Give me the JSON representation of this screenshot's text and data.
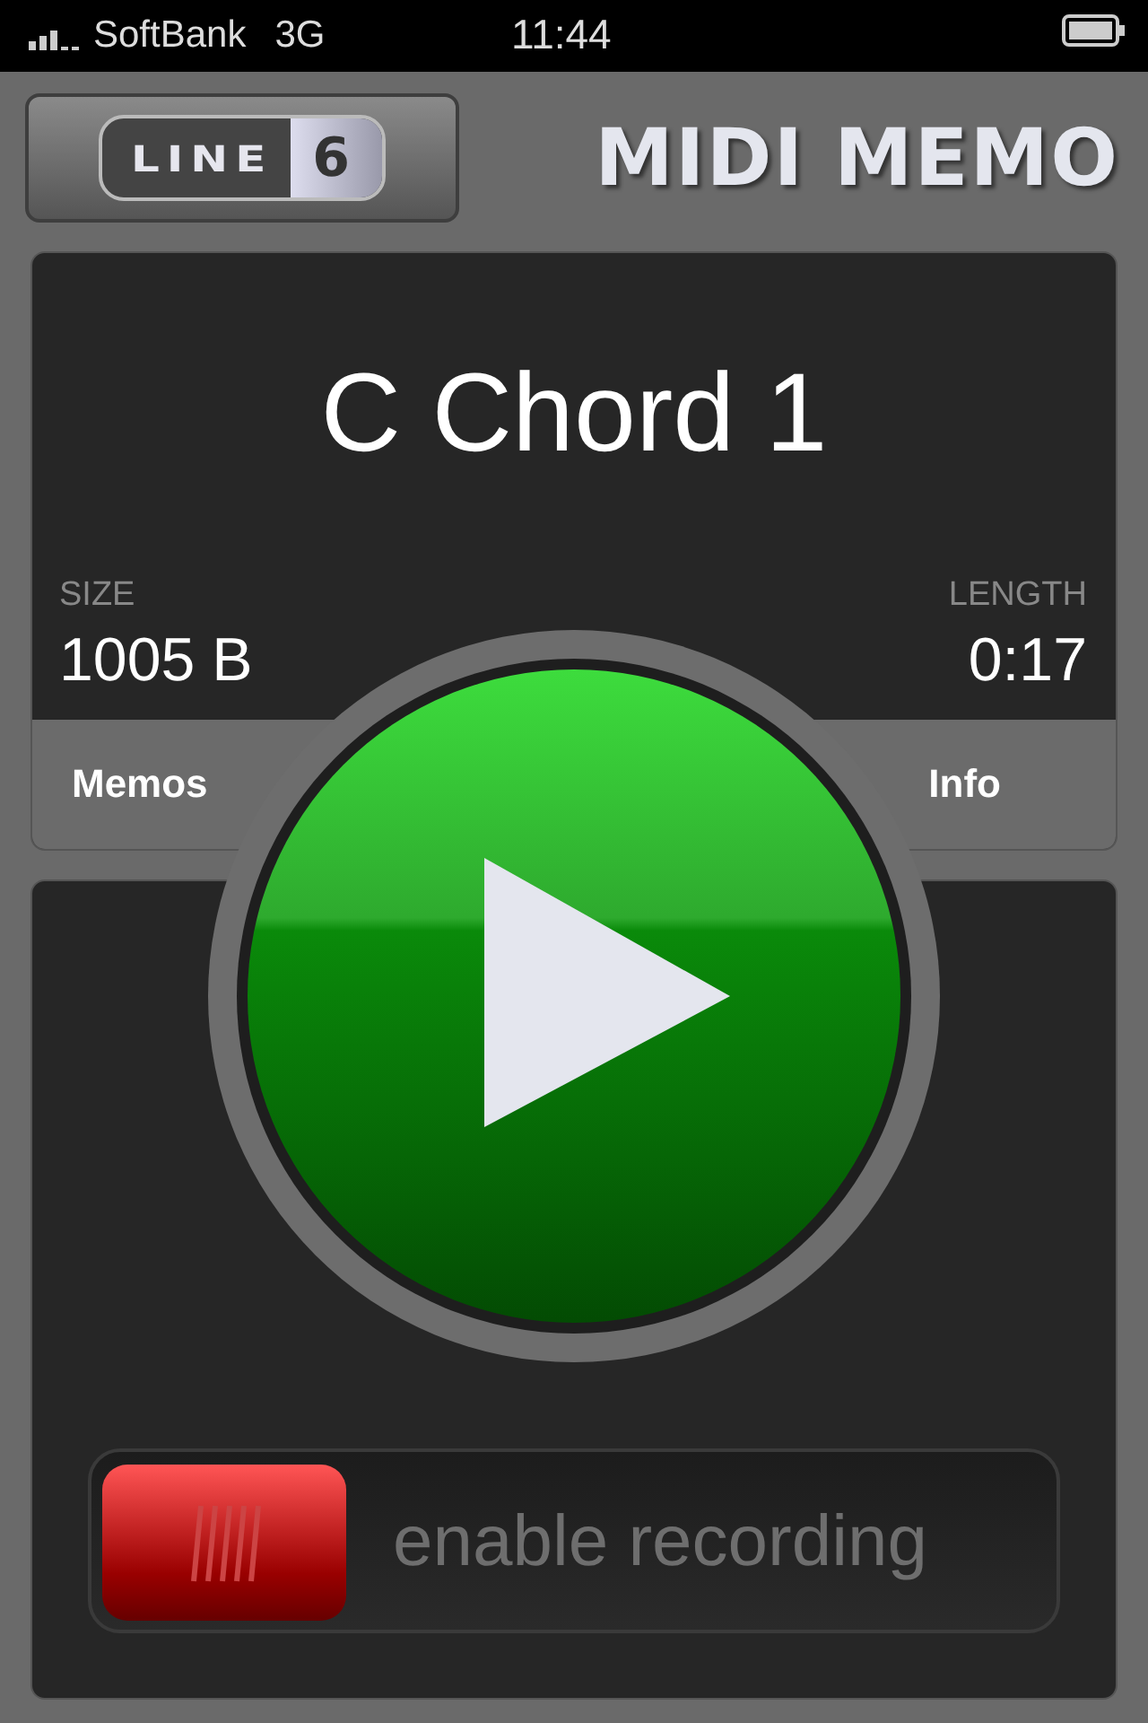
{
  "status_bar": {
    "carrier": "SoftBank",
    "network": "3G",
    "time": "11:44"
  },
  "header": {
    "logo": {
      "word": "LINE",
      "mark": "6"
    },
    "title": "MIDI MEMO"
  },
  "memo": {
    "name": "C Chord 1",
    "size_label": "SIZE",
    "size": "1005 B",
    "length_label": "LENGTH",
    "length": "0:17"
  },
  "nav": {
    "left": "Memos",
    "right": "Info"
  },
  "recorder": {
    "label": "enable recording",
    "level": 0
  }
}
